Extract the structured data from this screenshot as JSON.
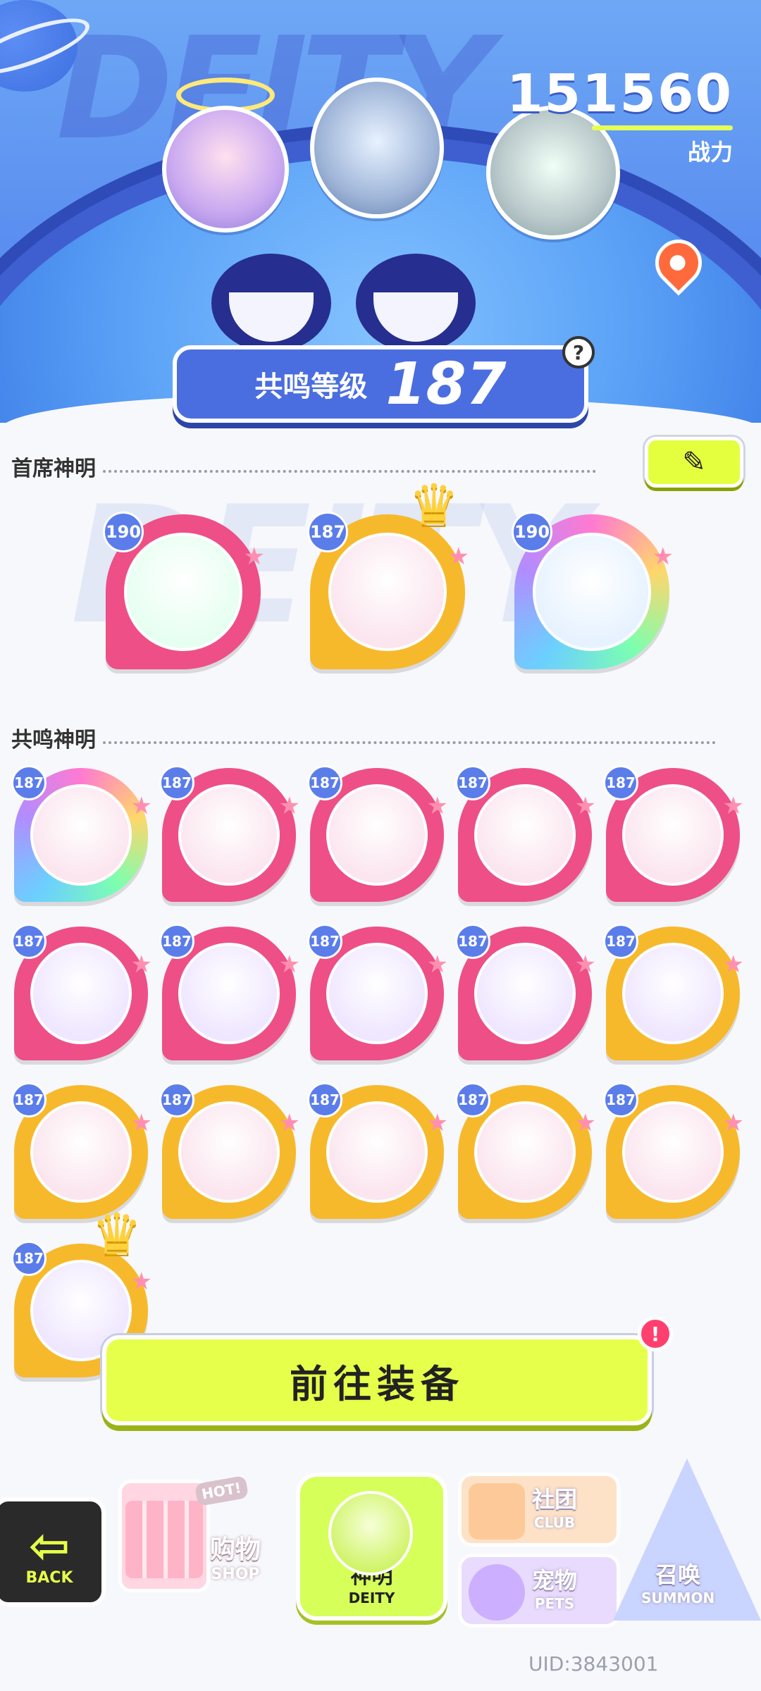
{
  "header": {
    "power_value": "151560",
    "power_label": "战力",
    "resonance_label": "共鸣等级",
    "resonance_level": "187",
    "help_symbol": "?"
  },
  "chief": {
    "title": "首席神明",
    "badges": [
      {
        "level": "190",
        "frame": "pink"
      },
      {
        "level": "187",
        "frame": "gold",
        "crown": true
      },
      {
        "level": "190",
        "frame": "rainbow"
      }
    ]
  },
  "resonance": {
    "title": "共鸣神明",
    "badges": [
      {
        "level": "187",
        "frame": "rainbow"
      },
      {
        "level": "187",
        "frame": "pink"
      },
      {
        "level": "187",
        "frame": "pink"
      },
      {
        "level": "187",
        "frame": "pink"
      },
      {
        "level": "187",
        "frame": "pink"
      },
      {
        "level": "187",
        "frame": "pink"
      },
      {
        "level": "187",
        "frame": "pink"
      },
      {
        "level": "187",
        "frame": "pink"
      },
      {
        "level": "187",
        "frame": "pink"
      },
      {
        "level": "187",
        "frame": "gold"
      },
      {
        "level": "187",
        "frame": "gold"
      },
      {
        "level": "187",
        "frame": "gold"
      },
      {
        "level": "187",
        "frame": "gold"
      },
      {
        "level": "187",
        "frame": "gold"
      },
      {
        "level": "187",
        "frame": "gold"
      },
      {
        "level": "187",
        "frame": "gold",
        "crown": true
      }
    ]
  },
  "actions": {
    "go_equip": "前往装备",
    "alert_symbol": "!"
  },
  "nav": {
    "back": "BACK",
    "shop_hot": "HOT!",
    "shop_zh": "购物",
    "shop_en": "SHOP",
    "deity_zh": "神明",
    "deity_en": "DEITY",
    "club_zh": "社团",
    "club_en": "CLUB",
    "pets_zh": "宠物",
    "pets_en": "PETS",
    "summon_zh": "召唤",
    "summon_en": "SUMMON"
  },
  "uid": "UID:3843001",
  "colors": {
    "accent": "#e6ff4a",
    "header_blue": "#5b8ff0",
    "frame_pink": "#ee4f86",
    "frame_gold": "#f7b92c"
  },
  "icons": [
    "planet-icon",
    "pin-icon",
    "help-icon",
    "pencil-icon",
    "crown-icon",
    "star-icon",
    "arrow-icon",
    "vending-icon",
    "bag-icon",
    "paw-icon",
    "summon-icon"
  ]
}
